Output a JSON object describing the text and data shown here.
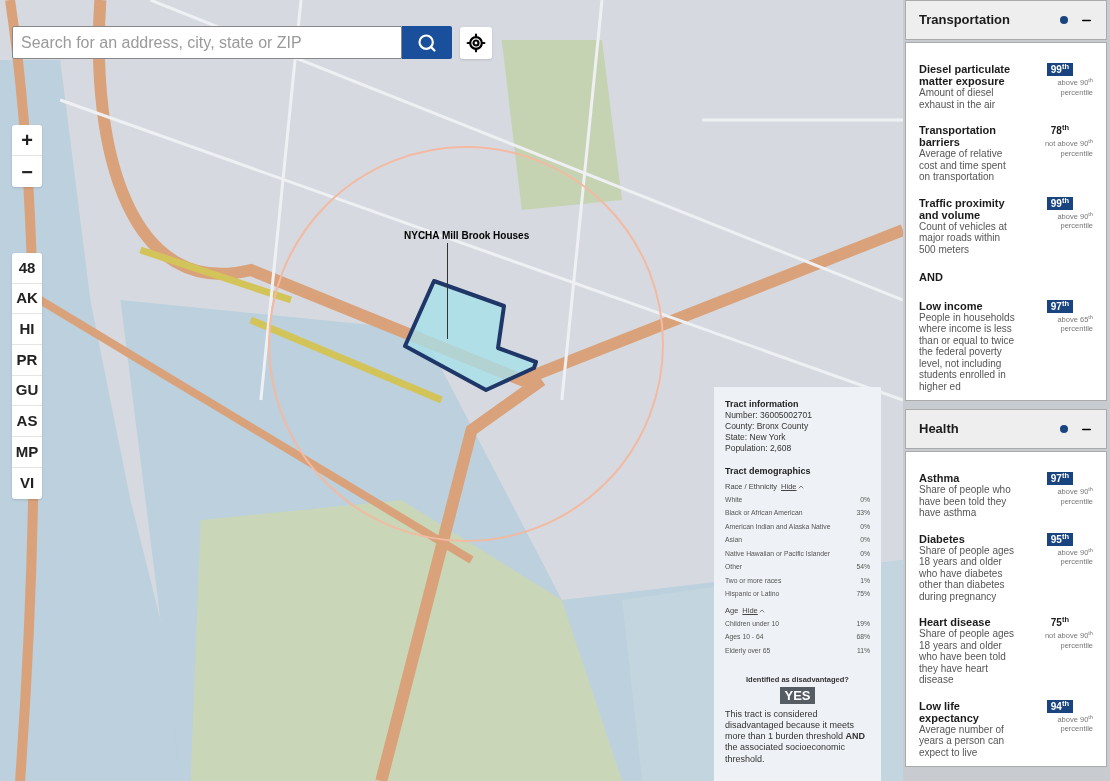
{
  "search": {
    "placeholder": "Search for an address, city, state or ZIP"
  },
  "zoom_controls": [
    "+",
    "−"
  ],
  "territories": [
    "48",
    "AK",
    "HI",
    "PR",
    "GU",
    "AS",
    "MP",
    "VI"
  ],
  "map_annotation": {
    "label": "NYCHA Mill Brook Houses"
  },
  "tract_panel": {
    "info_title": "Tract information",
    "info_lines": [
      "Number: 36005002701",
      "County: Bronx County",
      "State: New York",
      "Population: 2,608"
    ],
    "demographics_title": "Tract demographics",
    "groups": [
      {
        "label": "Race / Ethnicity",
        "toggle": "Hide",
        "expanded": true,
        "rows": [
          {
            "name": "White",
            "value": "0%"
          },
          {
            "name": "Black or African American",
            "value": "33%"
          },
          {
            "name": "American Indian and Alaska Native",
            "value": "0%"
          },
          {
            "name": "Asian",
            "value": "0%"
          },
          {
            "name": "Native Hawaiian or Pacific Islander",
            "value": "0%"
          },
          {
            "name": "Other",
            "value": "54%"
          },
          {
            "name": "Two or more races",
            "value": "1%"
          },
          {
            "name": "Hispanic or Latino",
            "value": "75%"
          }
        ]
      },
      {
        "label": "Age",
        "toggle": "Hide",
        "expanded": true,
        "rows": [
          {
            "name": "Children under 10",
            "value": "19%"
          },
          {
            "name": "Ages 10 - 64",
            "value": "68%"
          },
          {
            "name": "Elderly over 65",
            "value": "11%"
          }
        ]
      }
    ],
    "question": "Identified as disadvantaged?",
    "answer": "YES",
    "explanation": "This tract is considered disadvantaged because it meets more than 1 burden threshold **AND** the associated socioeconomic threshold."
  },
  "categories": [
    {
      "title": "Transportation",
      "flagged": true,
      "expanded": true,
      "items": [
        {
          "kind": "indicator",
          "name": "Diesel particulate matter exposure",
          "description": "Amount of diesel exhaust in the air",
          "percentile": "99$^{th}$",
          "exceeds": true,
          "threshold": "above 90$^{th}$ percentile"
        },
        {
          "kind": "indicator",
          "name": "Transportation barriers",
          "description": "Average of relative cost and time spent on transportation",
          "percentile": "78$^{th}$",
          "exceeds": false,
          "threshold": "not above 90$^{th}$ percentile"
        },
        {
          "kind": "indicator",
          "name": "Traffic proximity and volume",
          "description": "Count of vehicles at major roads within 500 meters",
          "percentile": "99$^{th}$",
          "exceeds": true,
          "threshold": "above 90$^{th}$ percentile"
        },
        {
          "kind": "connector",
          "text": "AND"
        },
        {
          "kind": "indicator",
          "name": "Low income",
          "description": "People in households where income is less than or equal to twice the federal poverty level, not including students enrolled in higher ed",
          "percentile": "97$^{th}$",
          "exceeds": true,
          "threshold": "above 65$^{th}$ percentile"
        }
      ]
    },
    {
      "title": "Health",
      "flagged": true,
      "expanded": true,
      "items": [
        {
          "kind": "indicator",
          "name": "Asthma",
          "description": "Share of people who have been told they have asthma",
          "percentile": "97$^{th}$",
          "exceeds": true,
          "threshold": "above 90$^{th}$ percentile"
        },
        {
          "kind": "indicator",
          "name": "Diabetes",
          "description": "Share of people ages 18 years and older who have diabetes other than diabetes during pregnancy",
          "percentile": "95$^{th}$",
          "exceeds": true,
          "threshold": "above 90$^{th}$ percentile"
        },
        {
          "kind": "indicator",
          "name": "Heart disease",
          "description": "Share of people ages 18 years and older who have been told they have heart disease",
          "percentile": "75$^{th}$",
          "exceeds": false,
          "threshold": "not above 90$^{th}$ percentile"
        },
        {
          "kind": "indicator",
          "name": "Low life expectancy",
          "description": "Average number of years a person can expect to live",
          "percentile": "94$^{th}$",
          "exceeds": true,
          "threshold": "above 90$^{th}$ percentile"
        }
      ]
    }
  ]
}
